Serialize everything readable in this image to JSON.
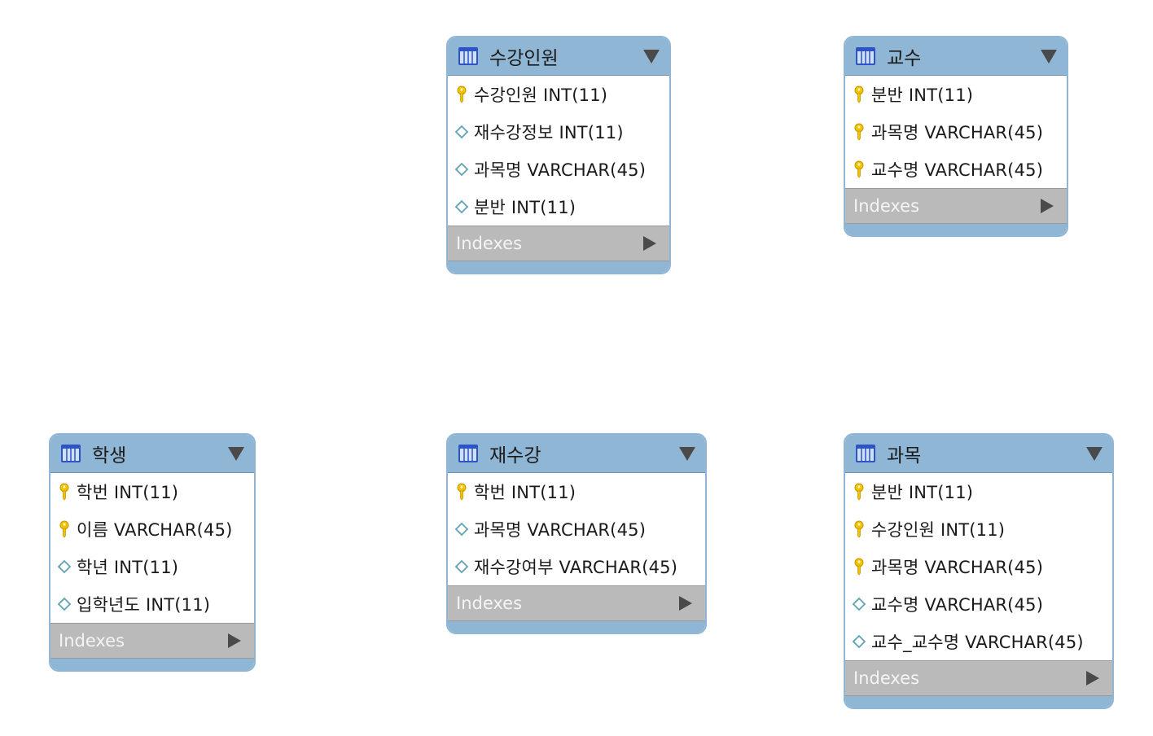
{
  "diagram": {
    "indexes_label": "Indexes",
    "tables": [
      {
        "name": "수강인원",
        "columns": [
          {
            "text": "수강인원 INT(11)",
            "key": "primary"
          },
          {
            "text": "재수강정보 INT(11)",
            "key": "none"
          },
          {
            "text": "과목명 VARCHAR(45)",
            "key": "none"
          },
          {
            "text": "분반 INT(11)",
            "key": "none"
          }
        ]
      },
      {
        "name": "교수",
        "columns": [
          {
            "text": "분반 INT(11)",
            "key": "primary"
          },
          {
            "text": "과목명 VARCHAR(45)",
            "key": "primary"
          },
          {
            "text": "교수명 VARCHAR(45)",
            "key": "primary"
          }
        ]
      },
      {
        "name": "학생",
        "columns": [
          {
            "text": "학번 INT(11)",
            "key": "primary"
          },
          {
            "text": "이름 VARCHAR(45)",
            "key": "primary"
          },
          {
            "text": "학년 INT(11)",
            "key": "none"
          },
          {
            "text": "입학년도 INT(11)",
            "key": "none"
          }
        ]
      },
      {
        "name": "재수강",
        "columns": [
          {
            "text": "학번 INT(11)",
            "key": "primary"
          },
          {
            "text": "과목명 VARCHAR(45)",
            "key": "none"
          },
          {
            "text": "재수강여부 VARCHAR(45)",
            "key": "none"
          }
        ]
      },
      {
        "name": "과목",
        "columns": [
          {
            "text": "분반 INT(11)",
            "key": "primary"
          },
          {
            "text": "수강인원 INT(11)",
            "key": "primary"
          },
          {
            "text": "과목명 VARCHAR(45)",
            "key": "primary"
          },
          {
            "text": "교수명 VARCHAR(45)",
            "key": "none"
          },
          {
            "text": "교수_교수명 VARCHAR(45)",
            "key": "none"
          }
        ]
      }
    ]
  },
  "colors": {
    "header": "#8fb6d4",
    "indexes_bar": "#bababa",
    "key_icon": "#f2c200",
    "column_icon": "#5fa3b5"
  },
  "icons": {
    "table": "table-icon",
    "primary_key": "key-icon",
    "column": "diamond-icon",
    "collapse": "triangle-down-icon",
    "expand": "triangle-right-icon"
  }
}
